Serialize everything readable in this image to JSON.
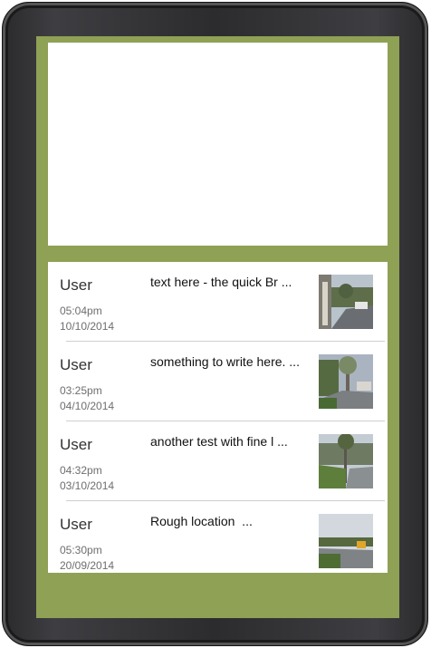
{
  "feed": {
    "items": [
      {
        "user": "User",
        "time": "05:04pm",
        "date": "10/10/2014",
        "text": "text here - the quick Br ...",
        "photo_icon": "street-photo-thumbnail"
      },
      {
        "user": "User",
        "time": "03:25pm",
        "date": "04/10/2014",
        "text": "something to write here. ...",
        "photo_icon": "street-photo-thumbnail"
      },
      {
        "user": "User",
        "time": "04:32pm",
        "date": "03/10/2014",
        "text": "another test with fine l ...",
        "photo_icon": "street-photo-thumbnail"
      },
      {
        "user": "User",
        "time": "05:30pm",
        "date": "20/09/2014",
        "text": "Rough location  ...",
        "photo_icon": "street-photo-thumbnail"
      }
    ]
  },
  "colors": {
    "screen_background": "#8fa155",
    "device_frame": "#2c2c2e",
    "panel_background": "#ffffff"
  }
}
